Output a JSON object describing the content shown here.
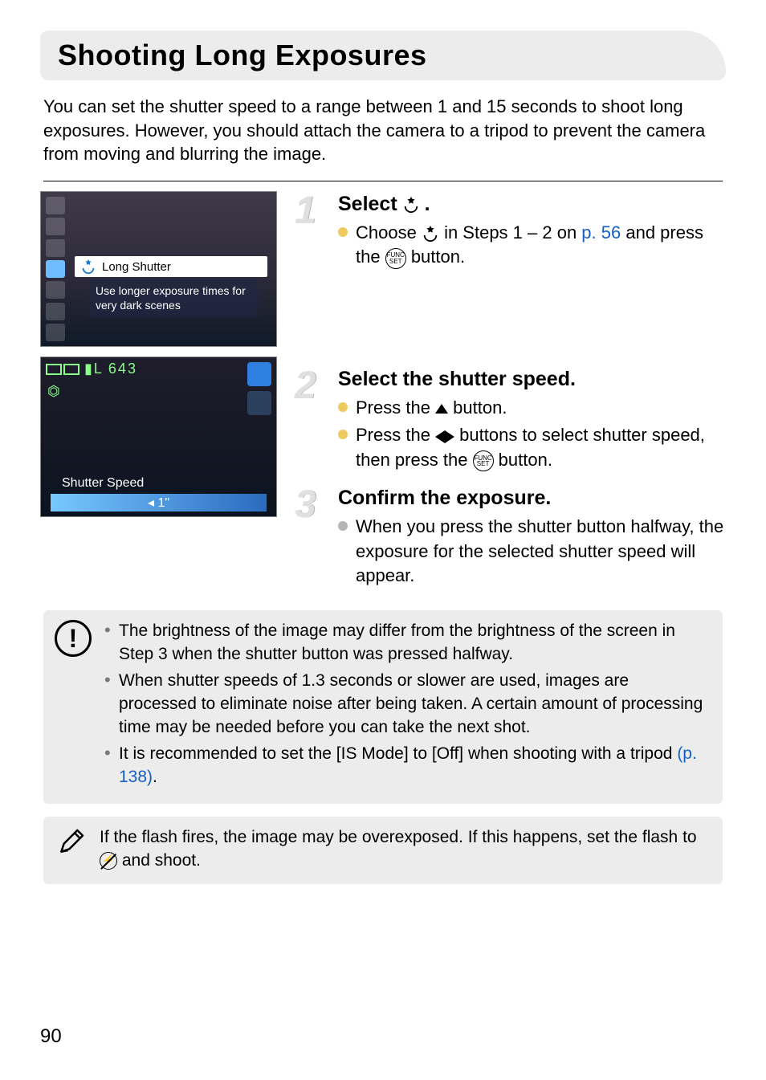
{
  "title": "Shooting Long Exposures",
  "intro": "You can set the shutter speed to a range between 1 and 15 seconds to shoot long exposures. However, you should attach the camera to a tripod to prevent the camera from moving and blurring the image.",
  "shot1": {
    "mode_label": "Long Shutter",
    "desc": "Use longer exposure times for very dark scenes"
  },
  "shot2": {
    "counter": "643",
    "ss_label": "Shutter Speed",
    "ss_value": "1\""
  },
  "step1": {
    "title_pre": "Select ",
    "title_post": ".",
    "bullet_pre": "Choose ",
    "bullet_mid": " in Steps 1 – 2 on ",
    "link": "p. 56",
    "bullet_post": " and press the ",
    "bullet_end": " button."
  },
  "step2": {
    "title": "Select the shutter speed.",
    "b1_pre": "Press the ",
    "b1_post": " button.",
    "b2_pre": "Press the ",
    "b2_mid": " buttons to select shutter speed, then press the ",
    "b2_post": " button."
  },
  "step3": {
    "title": "Confirm the exposure.",
    "b1": "When you press the shutter button halfway, the exposure for the selected shutter speed will appear."
  },
  "warn": {
    "i1": "The brightness of the image may differ from the brightness of the screen in Step 3 when the shutter button was pressed halfway.",
    "i2": "When shutter speeds of 1.3 seconds or slower are used, images are processed to eliminate noise after being taken. A certain amount of processing time may be needed before you can take the next shot.",
    "i3_pre": "It is recommended to set the [IS Mode] to [Off] when shooting with a tripod ",
    "i3_link": "(p. 138)",
    "i3_post": "."
  },
  "tip_pre": "If the flash fires, the image may be overexposed. If this happens, set the flash to ",
  "tip_post": " and shoot.",
  "page_num": "90"
}
